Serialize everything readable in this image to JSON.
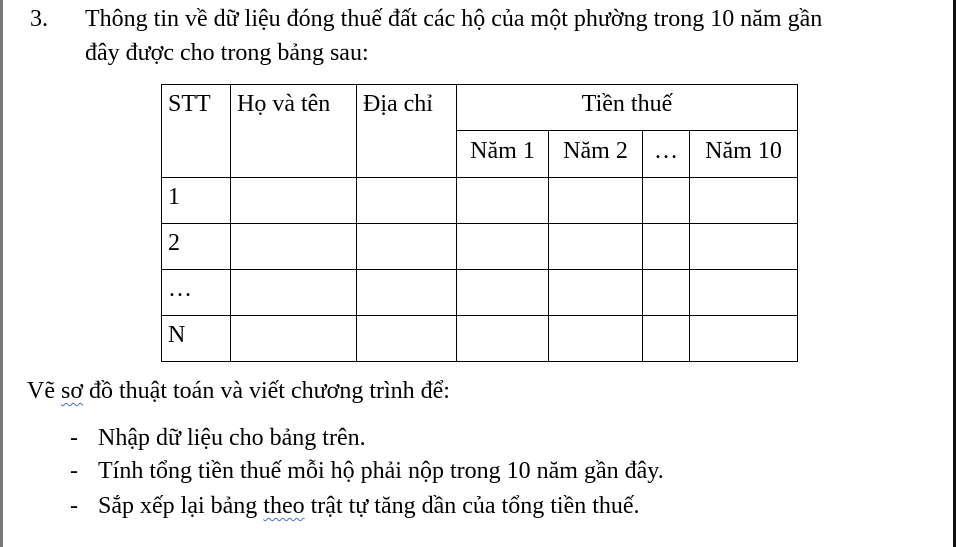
{
  "question": {
    "number": "3.",
    "line1": "Thông tin về dữ liệu đóng thuế đất các hộ của một phường trong 10 năm gần",
    "line2": "đây được cho trong bảng sau:"
  },
  "table": {
    "headers": {
      "stt": "STT",
      "name": "Họ và tên",
      "address": "Địa chỉ",
      "tax": "Tiền thuế",
      "years": [
        "Năm 1",
        "Năm 2",
        "…",
        "Năm 10"
      ]
    },
    "rows": [
      "1",
      "2",
      "…",
      "N"
    ]
  },
  "instructions": {
    "intro_pre": "Vẽ ",
    "intro_flag": "sơ",
    "intro_post": " đồ thuật toán và viết chương trình để:",
    "bullet_dash": "-",
    "items": [
      "Nhập dữ liệu cho bảng trên.",
      "Tính tổng tiền thuế mỗi hộ phải nộp trong 10 năm gần đây."
    ],
    "item3_pre": "Sắp xếp lại bảng ",
    "item3_flag": "theo",
    "item3_post": " trật tự tăng dần của tổng tiền thuế."
  }
}
